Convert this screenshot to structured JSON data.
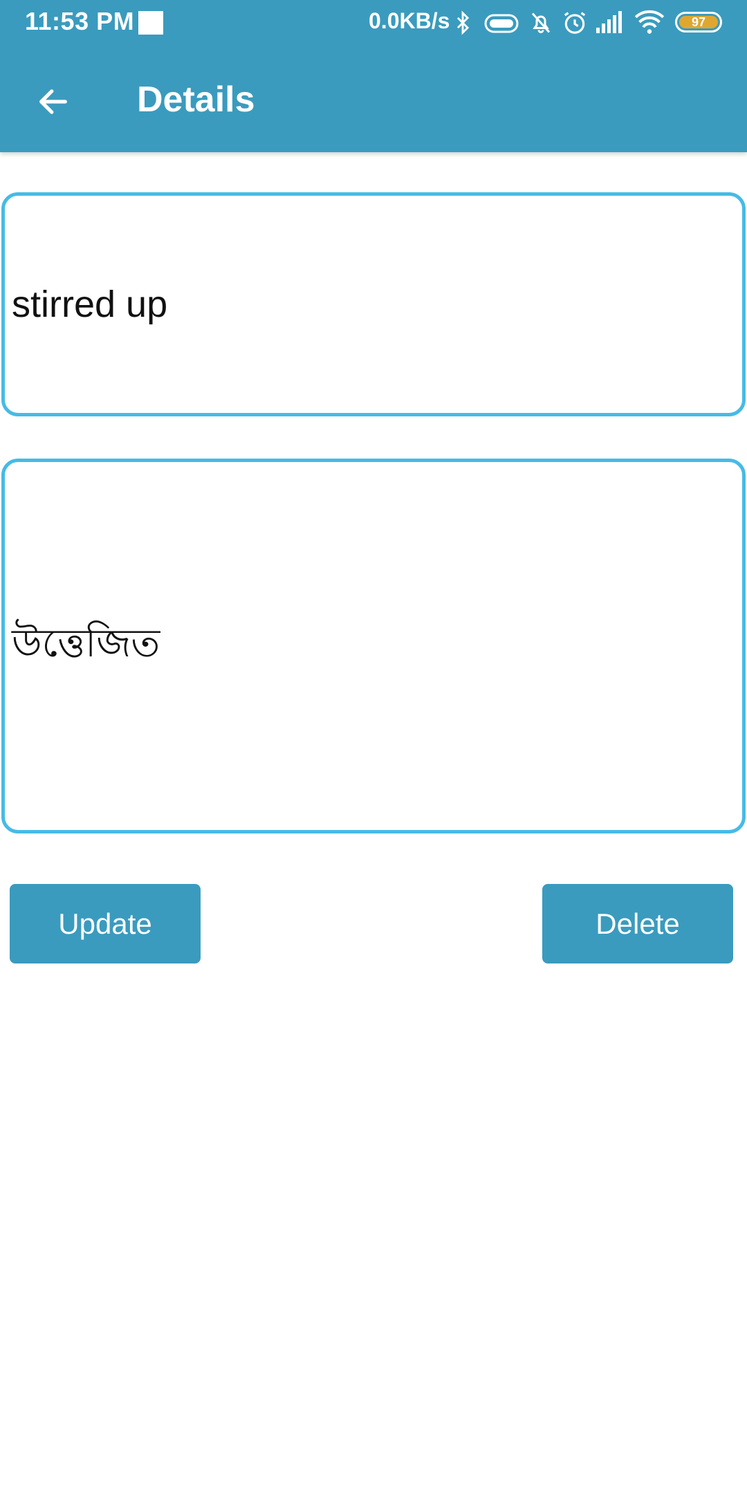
{
  "status_bar": {
    "time": "11:53 PM",
    "network_speed": "0.0KB/s",
    "battery_level": "97",
    "battery_color": "#e0a730"
  },
  "app_bar": {
    "title": "Details",
    "back_icon": "arrow-left-icon",
    "color": "#3a9bbe"
  },
  "form": {
    "word_value": "stirred up",
    "meaning_value": "উত্তেজিত",
    "border_color": "#46bbe6"
  },
  "actions": {
    "update_label": "Update",
    "delete_label": "Delete"
  }
}
